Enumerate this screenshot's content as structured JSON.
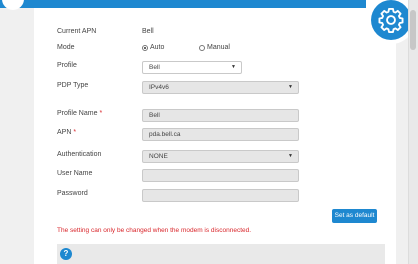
{
  "apn_settings": {
    "current_apn": {
      "label": "Current APN",
      "value": "Bell"
    },
    "mode": {
      "label": "Mode",
      "options": [
        "Auto",
        "Manual"
      ],
      "selected": "Auto"
    },
    "profile": {
      "label": "Profile",
      "value": "Bell"
    },
    "pdp_type": {
      "label": "PDP Type",
      "value": "IPv4v6"
    },
    "profile_name": {
      "label": "Profile Name",
      "value": "Bell",
      "required": "*"
    },
    "apn": {
      "label": "APN",
      "value": "pda.bell.ca",
      "required": "*"
    },
    "authentication": {
      "label": "Authentication",
      "value": "NONE"
    },
    "user_name": {
      "label": "User Name",
      "value": ""
    },
    "password": {
      "label": "Password",
      "value": ""
    }
  },
  "buttons": {
    "set_as_default": "Set as default"
  },
  "warning_text": "The setting can only be changed when the modem is disconnected.",
  "help": {
    "icon_text": "?"
  },
  "colors": {
    "accent": "#1e88d0",
    "warning": "#d9262b",
    "field_bg": "#e6e6e6"
  },
  "icons": {
    "settings": "gear-icon",
    "help": "help-icon",
    "dropdown": "caret-down-icon"
  }
}
